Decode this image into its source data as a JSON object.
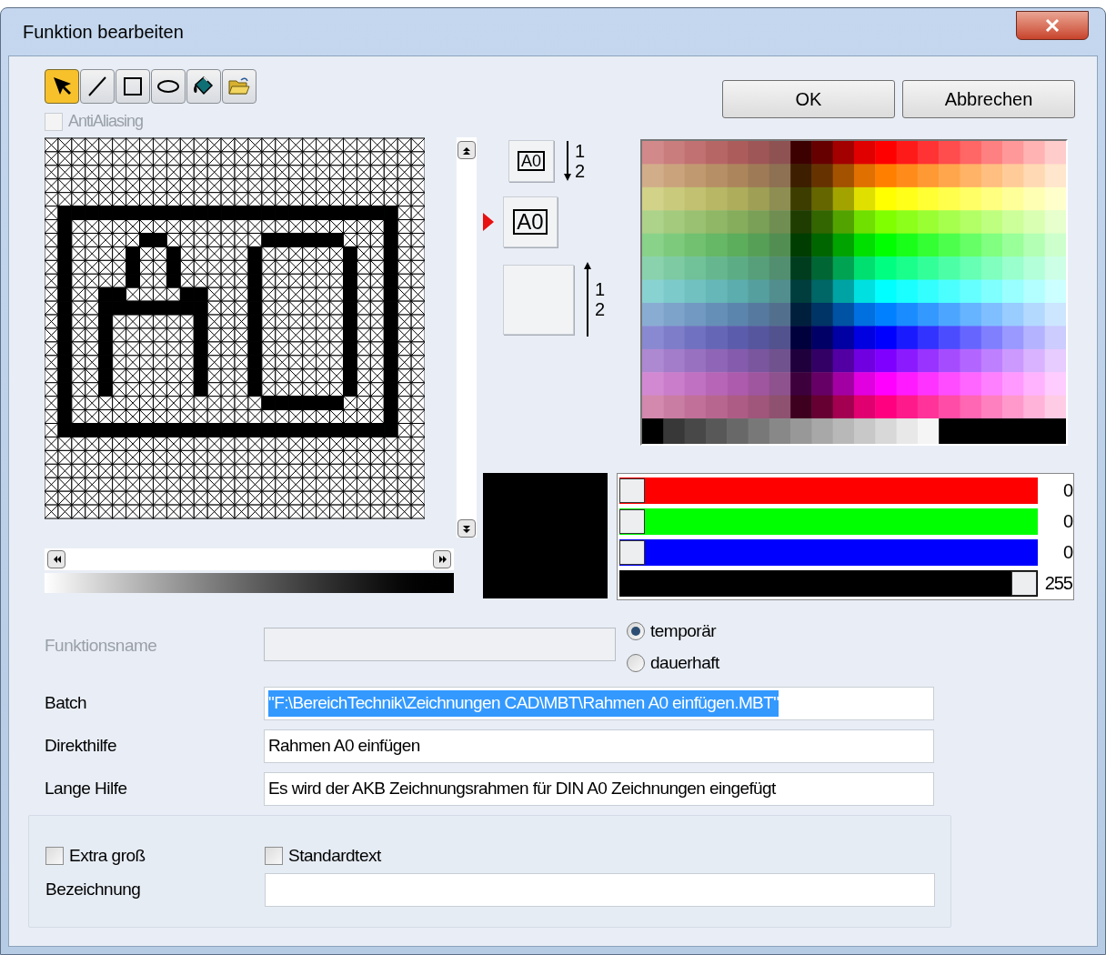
{
  "window": {
    "title": "Funktion bearbeiten"
  },
  "toolbar": [
    {
      "kind": "pointer",
      "selected": true
    },
    {
      "kind": "line",
      "selected": false
    },
    {
      "kind": "rectangle",
      "selected": false
    },
    {
      "kind": "ellipse",
      "selected": false
    },
    {
      "kind": "fill",
      "selected": false
    },
    {
      "kind": "open",
      "selected": false
    }
  ],
  "anti_aliasing": {
    "label": "AntiAliasing",
    "checked": false,
    "disabled": true
  },
  "buttons": [
    {
      "label": "OK"
    },
    {
      "label": "Abbrechen"
    }
  ],
  "previews": [
    {
      "kind": "down",
      "text": "A0",
      "selected": false,
      "digits": [
        "1",
        "2"
      ]
    },
    {
      "kind": "plain",
      "text": "A0",
      "selected": true
    },
    {
      "kind": "up",
      "selected": false,
      "digits": [
        "1",
        "2"
      ]
    }
  ],
  "sliders": [
    {
      "color": "#ff0000",
      "level": 0,
      "reading": "0"
    },
    {
      "color": "#00ff00",
      "level": 0,
      "reading": "0"
    },
    {
      "color": "#0000ff",
      "level": 0,
      "reading": "0"
    },
    {
      "color": "#000000",
      "level": 1,
      "reading": "255"
    }
  ],
  "name_field": {
    "label": "Funktionsname",
    "disabled": true
  },
  "radios": [
    {
      "label": "temporär",
      "selected": true
    },
    {
      "label": "dauerhaft",
      "selected": false
    }
  ],
  "fields": [
    {
      "label": "Batch",
      "value": "\"F:\\BereichTechnik\\Zeichnungen CAD\\MBT\\Rahmen A0 einfügen.MBT\"",
      "text_selected": true
    },
    {
      "label": "Direkthilfe",
      "value": "Rahmen A0 einfügen",
      "text_selected": false
    },
    {
      "label": "Lange Hilfe",
      "value": "Es wird der AKB Zeichnungsrahmen für DIN A0 Zeichnungen eingefügt",
      "text_selected": false
    }
  ],
  "group": {
    "checkboxes": [
      {
        "label": "Extra groß",
        "checked": false
      },
      {
        "label": "Standardtext",
        "checked": false
      }
    ],
    "field_label": "Bezeichnung"
  }
}
